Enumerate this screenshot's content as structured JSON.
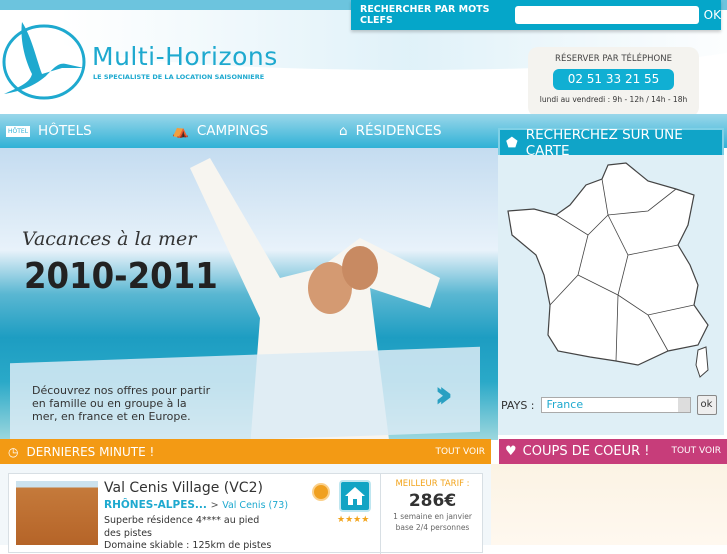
{
  "search": {
    "label": "RECHERCHER PAR MOTS CLEFS",
    "placeholder": "",
    "ok": "OK"
  },
  "brand": {
    "name": "Multi-Horizons",
    "tagline": "LE SPECIALISTE DE LA LOCATION SAISONNIERE"
  },
  "phone": {
    "title": "RÉSERVER PAR TÉLÉPHONE",
    "number": "02 51 33 21 55",
    "hours": "lundi au vendredi : 9h - 12h / 14h - 18h"
  },
  "nav": [
    {
      "label": "HÔTELS",
      "icon": "hotel-icon",
      "badge": "HÔTEL"
    },
    {
      "label": "CAMPINGS",
      "icon": "tent-icon"
    },
    {
      "label": "RÉSIDENCES",
      "icon": "house-icon"
    }
  ],
  "map": {
    "title": "RECHERCHEZ SUR UNE CARTE",
    "country_label": "PAYS :",
    "country": "France",
    "ok": "ok"
  },
  "hero": {
    "line1": "Vacances à la mer",
    "line2": "2010-2011",
    "text": "Découvrez nos offres pour partir en famille ou en groupe à la mer, en france et en Europe."
  },
  "last_minute": {
    "title": "DERNIERES MINUTE !",
    "see_all": "TOUT VOIR"
  },
  "favorites": {
    "title": "COUPS DE COEUR !",
    "see_all": "TOUT VOIR"
  },
  "offer": {
    "title": "Val Cenis Village (VC2)",
    "region": "RHÔNES-ALPES...",
    "sep": ">",
    "town": "Val Cenis (73)",
    "desc": "Superbe résidence 4**** au pied des pistes",
    "desc2": "Domaine skiable : 125km de pistes",
    "stars": "★★★★",
    "price_label": "MEILLEUR TARIF :",
    "price": "286€",
    "price_note1": "1 semaine en janvier",
    "price_note2": "base 2/4 personnes"
  },
  "colors": {
    "accent": "#05a6c9",
    "orange": "#f39a14",
    "pink": "#c73d7a"
  }
}
